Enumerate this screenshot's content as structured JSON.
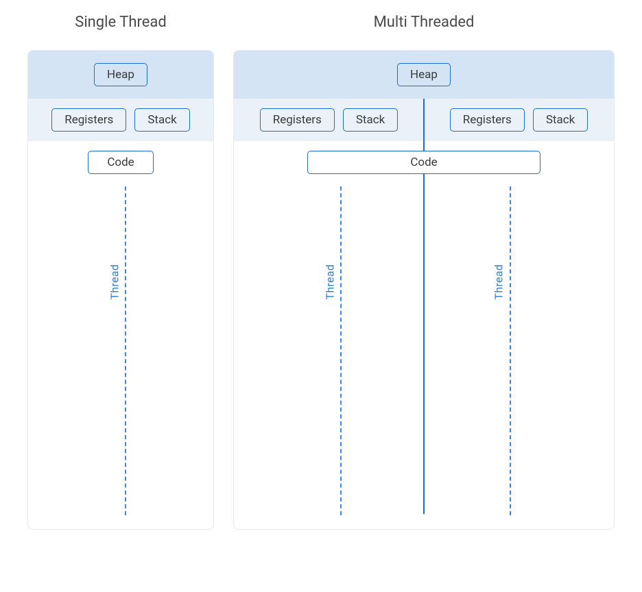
{
  "titles": {
    "single": "Single Thread",
    "multi": "Multi Threaded"
  },
  "boxes": {
    "heap": "Heap",
    "registers": "Registers",
    "stack": "Stack",
    "code": "Code"
  },
  "thread_label": "Thread",
  "colors": {
    "border_blue": "#186fcf",
    "dash_blue": "#3a86e6",
    "heap_bg": "#d4e4f4",
    "reg_bg": "#eaf1f9",
    "panel_border": "#e5e9ef",
    "text_dark": "#3b3b3b",
    "title_text": "#4a4a4a"
  },
  "structure": {
    "single_thread": {
      "shared": [
        "heap"
      ],
      "per_thread": [
        "registers",
        "stack"
      ],
      "code_shared": true,
      "thread_count": 1
    },
    "multi_threaded": {
      "shared": [
        "heap",
        "code"
      ],
      "per_thread": [
        "registers",
        "stack"
      ],
      "thread_count": 2
    }
  }
}
